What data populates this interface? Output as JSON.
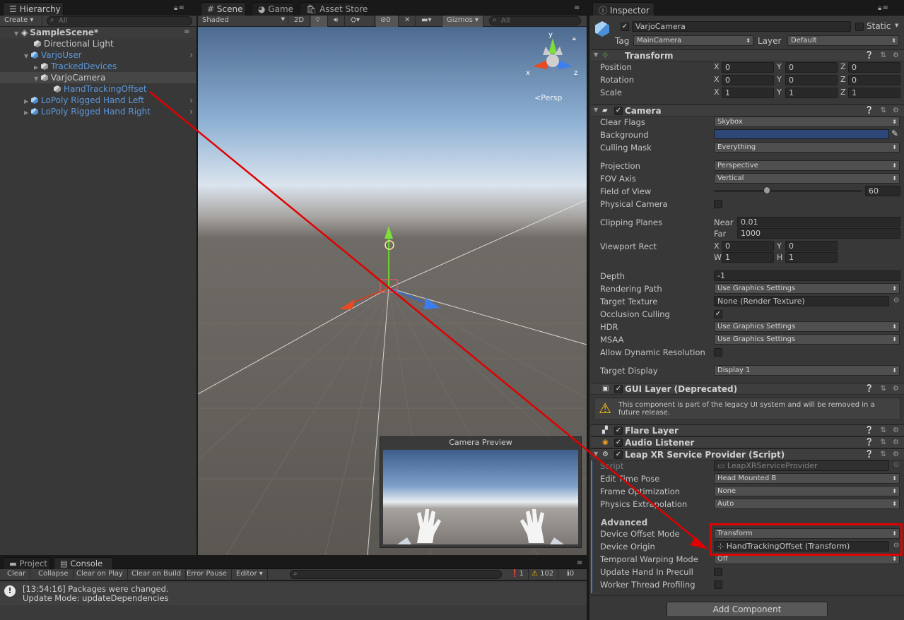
{
  "hierarchy": {
    "tab": "Hierarchy",
    "create": "Create ▾",
    "search": "All",
    "scene": "SampleScene*",
    "items": [
      {
        "label": "Directional Light",
        "blue": false
      },
      {
        "label": "VarjoUser",
        "blue": true
      },
      {
        "label": "TrackedDevices",
        "blue": true
      },
      {
        "label": "VarjoCamera",
        "blue": false
      },
      {
        "label": "HandTrackingOffset",
        "blue": true
      },
      {
        "label": "LoPoly Rigged Hand Left",
        "blue": true
      },
      {
        "label": "LoPoly Rigged Hand Right",
        "blue": true
      }
    ]
  },
  "scene": {
    "tabs": [
      "Scene",
      "Game",
      "Asset Store"
    ],
    "shading": "Shaded",
    "mode2d": "2D",
    "hidden_count": "0",
    "gizmos": "Gizmos ▾",
    "search": "All",
    "persp": "Persp",
    "preview_title": "Camera Preview",
    "axis_x": "x",
    "axis_y": "y",
    "axis_z": "z"
  },
  "console": {
    "tabs": [
      "Project",
      "Console"
    ],
    "buttons": [
      "Clear",
      "Collapse",
      "Clear on Play",
      "Clear on Build",
      "Error Pause",
      "Editor ▾"
    ],
    "counts": {
      "errors": "1",
      "warnings": "102",
      "info": "0"
    },
    "log_line1": "[13:54:16] Packages were changed.",
    "log_line2": "Update Mode: updateDependencies"
  },
  "inspector": {
    "tab": "Inspector",
    "name": "VarjoCamera",
    "static": "Static",
    "tag_label": "Tag",
    "tag": "MainCamera",
    "layer_label": "Layer",
    "layer": "Default",
    "transform": {
      "title": "Transform",
      "position_label": "Position",
      "rotation_label": "Rotation",
      "scale_label": "Scale",
      "position": [
        "0",
        "0",
        "0"
      ],
      "rotation": [
        "0",
        "0",
        "0"
      ],
      "scale": [
        "1",
        "1",
        "1"
      ]
    },
    "camera": {
      "title": "Camera",
      "clear_flags_label": "Clear Flags",
      "clear_flags": "Skybox",
      "background_label": "Background",
      "background_color": "#2c4778",
      "culling_label": "Culling Mask",
      "culling": "Everything",
      "projection_label": "Projection",
      "projection": "Perspective",
      "fov_axis_label": "FOV Axis",
      "fov_axis": "Vertical",
      "fov_label": "Field of View",
      "fov": "60",
      "fov_fraction": 0.35,
      "physical_label": "Physical Camera",
      "clipping_label": "Clipping Planes",
      "near_label": "Near",
      "near": "0.01",
      "far_label": "Far",
      "far": "1000",
      "viewport_label": "Viewport Rect",
      "vx": "0",
      "vy": "0",
      "vw": "1",
      "vh": "1",
      "depth_label": "Depth",
      "depth": "-1",
      "rpath_label": "Rendering Path",
      "rpath": "Use Graphics Settings",
      "target_tex_label": "Target Texture",
      "target_tex": "None (Render Texture)",
      "occlusion_label": "Occlusion Culling",
      "hdr_label": "HDR",
      "hdr": "Use Graphics Settings",
      "msaa_label": "MSAA",
      "msaa": "Use Graphics Settings",
      "dyn_res_label": "Allow Dynamic Resolution",
      "target_disp_label": "Target Display",
      "target_disp": "Display 1"
    },
    "gui_layer": {
      "title": "GUI Layer (Deprecated)",
      "warning": "This component is part of the legacy UI system and will be removed in a future release."
    },
    "flare": {
      "title": "Flare Layer"
    },
    "audio": {
      "title": "Audio Listener"
    },
    "leap": {
      "title": "Leap XR Service Provider (Script)",
      "script_label": "Script",
      "script": "LeapXRServiceProvider",
      "edit_pose_label": "Edit Time Pose",
      "edit_pose": "Head Mounted B",
      "frame_opt_label": "Frame Optimization",
      "frame_opt": "None",
      "phys_ext_label": "Physics Extrapolation",
      "phys_ext": "Auto",
      "advanced": "Advanced",
      "offset_mode_label": "Device Offset Mode",
      "offset_mode": "Transform",
      "origin_label": "Device Origin",
      "origin": "HandTrackingOffset (Transform)",
      "warp_label": "Temporal Warping Mode",
      "warp": "Off",
      "precull_label": "Update Hand In Precull",
      "worker_label": "Worker Thread Profiling"
    },
    "add_component": "Add Component"
  }
}
